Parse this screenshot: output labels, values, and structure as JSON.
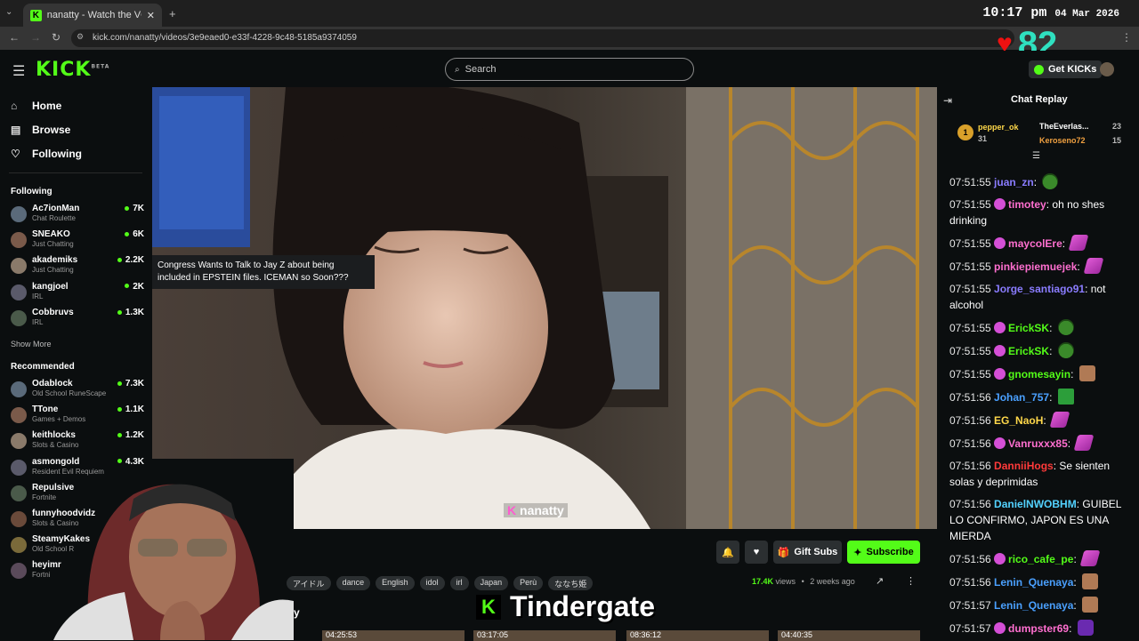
{
  "browser": {
    "tab_title": "nanatty - Watch the VOD o",
    "url": "kick.com/nanatty/videos/3e9eaed0-e33f-4228-9c48-5185a9374059",
    "clock_time": "10:17 pm",
    "clock_date": "04 Mar 2026",
    "heart_rate": "82"
  },
  "header": {
    "logo": "KICK",
    "logo_badge": "BETA",
    "search_placeholder": "Search",
    "get_kicks_label": "Get KICKs"
  },
  "sidebar": {
    "nav": [
      {
        "label": "Home",
        "icon": "home-icon"
      },
      {
        "label": "Browse",
        "icon": "browse-icon"
      },
      {
        "label": "Following",
        "icon": "heart-icon"
      }
    ],
    "following_heading": "Following",
    "following": [
      {
        "name": "Ac7ionMan",
        "category": "Chat Roulette",
        "viewers": "7K"
      },
      {
        "name": "SNEAKO",
        "category": "Just Chatting",
        "viewers": "6K"
      },
      {
        "name": "akademiks",
        "category": "Just Chatting",
        "viewers": "2.2K"
      },
      {
        "name": "kangjoel",
        "category": "IRL",
        "viewers": "2K"
      },
      {
        "name": "Cobbruvs",
        "category": "IRL",
        "viewers": "1.3K"
      }
    ],
    "show_more": "Show More",
    "recommended_heading": "Recommended",
    "recommended": [
      {
        "name": "Odablock",
        "category": "Old School RuneScape",
        "viewers": "7.3K"
      },
      {
        "name": "TTone",
        "category": "Games + Demos",
        "viewers": "1.1K"
      },
      {
        "name": "keithlocks",
        "category": "Slots & Casino",
        "viewers": "1.2K"
      },
      {
        "name": "asmongold",
        "category": "Resident Evil Requiem",
        "viewers": "4.3K"
      },
      {
        "name": "Repulsive",
        "category": "Fortnite",
        "viewers": ""
      },
      {
        "name": "funnyhoodvidz",
        "category": "Slots & Casino",
        "viewers": ""
      },
      {
        "name": "SteamyKakes",
        "category": "Old School R",
        "viewers": ""
      },
      {
        "name": "heyimr",
        "category": "Fortni",
        "viewers": ""
      }
    ]
  },
  "video": {
    "tooltip": "Congress Wants to Talk to Jay Z about being included in EPSTEIN files. ICEMAN so Soon???",
    "watermark": "nanatty",
    "channel_name": "nanatty",
    "gift_subs_label": "Gift Subs",
    "subscribe_label": "Subscribe",
    "tags": [
      "アイドル",
      "dance",
      "English",
      "idol",
      "irl",
      "Japan",
      "Perù",
      "ななち姫"
    ],
    "views_count": "17.4K",
    "views_suffix": "views",
    "age": "2 weeks ago",
    "overlay_text": "Tindergate",
    "thumb_times": [
      "04:25:53",
      "03:17:05",
      "08:36:12",
      "04:40:35"
    ]
  },
  "chat": {
    "title": "Chat Replay",
    "leaderboard": [
      {
        "rank": "1",
        "name": "pepper_ok",
        "count": "31"
      },
      {
        "name": "TheEverlas...",
        "count": "23"
      },
      {
        "name": "Keroseno72",
        "count": "15"
      }
    ],
    "messages": [
      {
        "time": "07:51:55",
        "user": "juan_zn",
        "color": "#8a7cff",
        "badge": false,
        "text": "",
        "emote": "pepe"
      },
      {
        "time": "07:51:55",
        "user": "timotey",
        "color": "#ff6fd0",
        "badge": true,
        "text": "oh no shes drinking",
        "emote": ""
      },
      {
        "time": "07:51:55",
        "user": "maycolEre",
        "color": "#ff6fd0",
        "badge": true,
        "text": "",
        "emote": "hand"
      },
      {
        "time": "07:51:55",
        "user": "pinkiepiemuejek",
        "color": "#ff6fd0",
        "badge": false,
        "text": "",
        "emote": "hand"
      },
      {
        "time": "07:51:55",
        "user": "Jorge_santiago91",
        "color": "#8a7cff",
        "badge": false,
        "text": "not alcohol",
        "emote": ""
      },
      {
        "time": "07:51:55",
        "user": "ErickSK",
        "color": "#53fc18",
        "badge": true,
        "text": "",
        "emote": "pepe"
      },
      {
        "time": "07:51:55",
        "user": "ErickSK",
        "color": "#53fc18",
        "badge": true,
        "text": "",
        "emote": "pepe"
      },
      {
        "time": "07:51:55",
        "user": "gnomesayin",
        "color": "#53fc18",
        "badge": true,
        "text": "",
        "emote": "face"
      },
      {
        "time": "07:51:56",
        "user": "Johan_757",
        "color": "#4aa0ff",
        "badge": false,
        "text": "",
        "emote": "green"
      },
      {
        "time": "07:51:56",
        "user": "EG_NaoH",
        "color": "#ffd84a",
        "badge": false,
        "text": "",
        "emote": "hand"
      },
      {
        "time": "07:51:56",
        "user": "Vanruxxx85",
        "color": "#ff6fd0",
        "badge": true,
        "text": "",
        "emote": "hand"
      },
      {
        "time": "07:51:56",
        "user": "DanniiHogs",
        "color": "#ff3a3a",
        "badge": false,
        "text": "Se sienten solas y deprimidas",
        "emote": ""
      },
      {
        "time": "07:51:56",
        "user": "DanielNWOBHM",
        "color": "#53d2ff",
        "badge": false,
        "text": "GUIBEL LO CONFIRMO, JAPON ES UNA MIERDA",
        "emote": ""
      },
      {
        "time": "07:51:56",
        "user": "rico_cafe_pe",
        "color": "#53fc18",
        "badge": true,
        "text": "",
        "emote": "hand"
      },
      {
        "time": "07:51:56",
        "user": "Lenin_Quenaya",
        "color": "#4aa0ff",
        "badge": false,
        "text": "",
        "emote": "face"
      },
      {
        "time": "07:51:57",
        "user": "Lenin_Quenaya",
        "color": "#4aa0ff",
        "badge": false,
        "text": "",
        "emote": "face"
      },
      {
        "time": "07:51:57",
        "user": "dumpster69",
        "color": "#ff6fd0",
        "badge": true,
        "text": "",
        "emote": "purple"
      }
    ]
  }
}
